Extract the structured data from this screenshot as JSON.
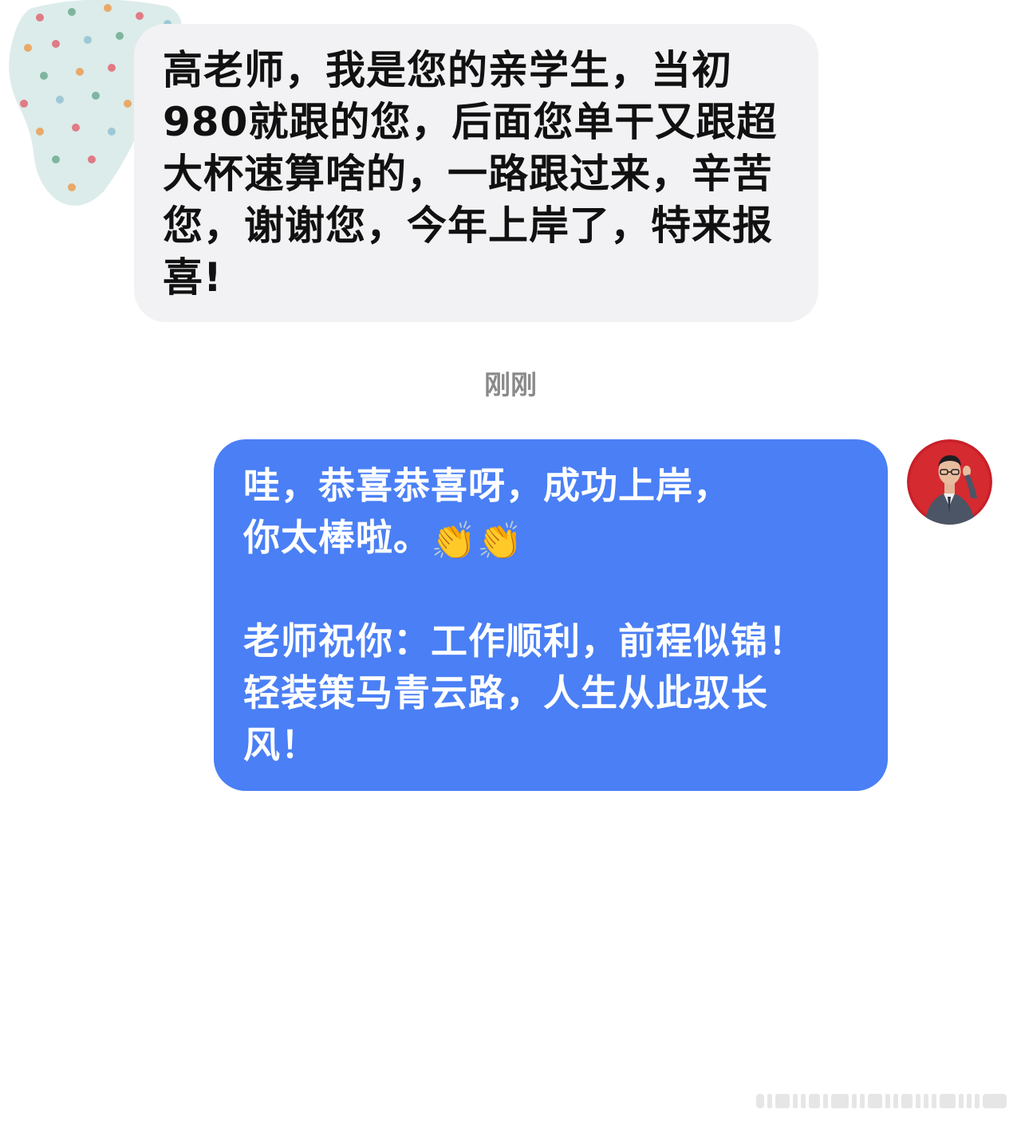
{
  "incoming": {
    "text": "高老师，我是您的亲学生，当初\n 980就跟的您，后面您单干又跟超\n大杯速算啥的，一路跟过来，辛苦\n您，谢谢您，今年上岸了，特来报\n喜!"
  },
  "timestamp": "刚刚",
  "outgoing": {
    "line1": "哇，恭喜恭喜呀，成功上岸，",
    "line2": "你太棒啦。",
    "clap1": "👏",
    "clap2": "👏",
    "line3": "老师祝你：工作顺利，前程似锦！\n轻装策马青云路，人生从此驭长\n风！"
  },
  "colors": {
    "incoming_bubble": "#f2f2f4",
    "outgoing_bubble": "#4a7ff5",
    "timestamp": "#8a8a8a"
  },
  "icons": {
    "left_avatar": "polka-dot-avatar",
    "right_avatar": "teacher-photo-avatar"
  }
}
